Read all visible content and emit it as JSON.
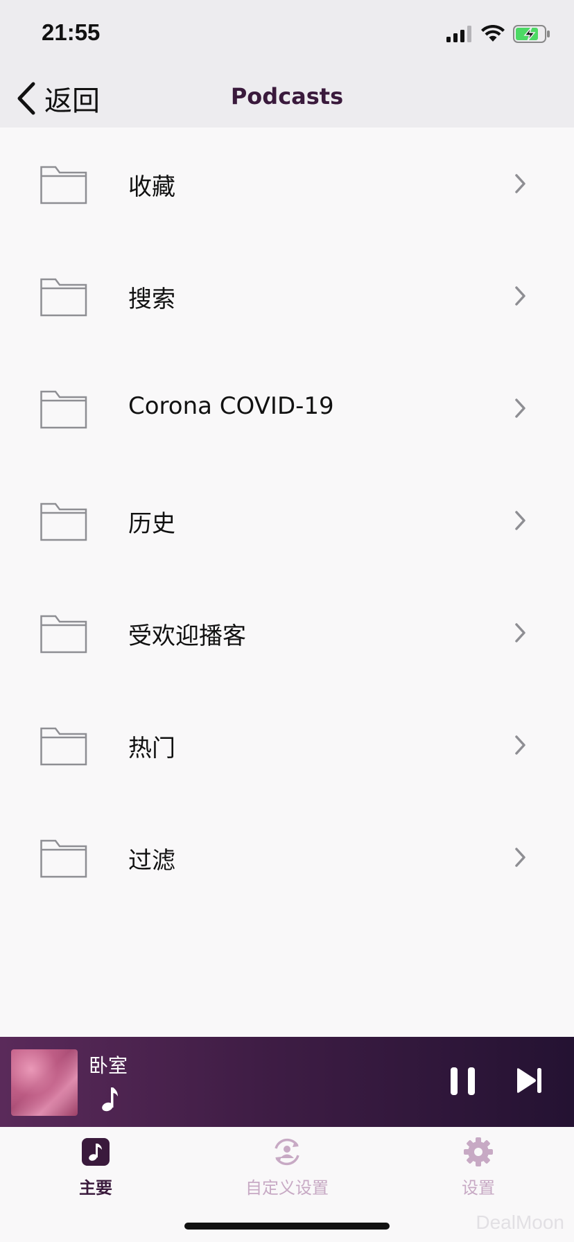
{
  "status_bar": {
    "time": "21:55"
  },
  "nav": {
    "back_label": "返回",
    "title": "Podcasts"
  },
  "list": {
    "items": [
      {
        "label": "收藏"
      },
      {
        "label": "搜索"
      },
      {
        "label": "Corona COVID-19"
      },
      {
        "label": "历史"
      },
      {
        "label": "受欢迎播客"
      },
      {
        "label": "热门"
      },
      {
        "label": "过滤"
      }
    ]
  },
  "player": {
    "room": "卧室"
  },
  "tabs": [
    {
      "label": "主要"
    },
    {
      "label": "自定义设置"
    },
    {
      "label": "设置"
    }
  ],
  "watermark": "DealMoon",
  "colors": {
    "accent": "#3a1a3c",
    "tab_inactive": "#c7a9c4",
    "battery_fill": "#4cd964"
  },
  "icons": {
    "status": [
      "cellular-signal-icon",
      "wifi-icon",
      "battery-charging-icon"
    ],
    "list_item": "folder-icon",
    "list_disclosure": "chevron-right-icon",
    "tabs": [
      "music-note-icon",
      "person-sync-icon",
      "gear-icon"
    ]
  }
}
